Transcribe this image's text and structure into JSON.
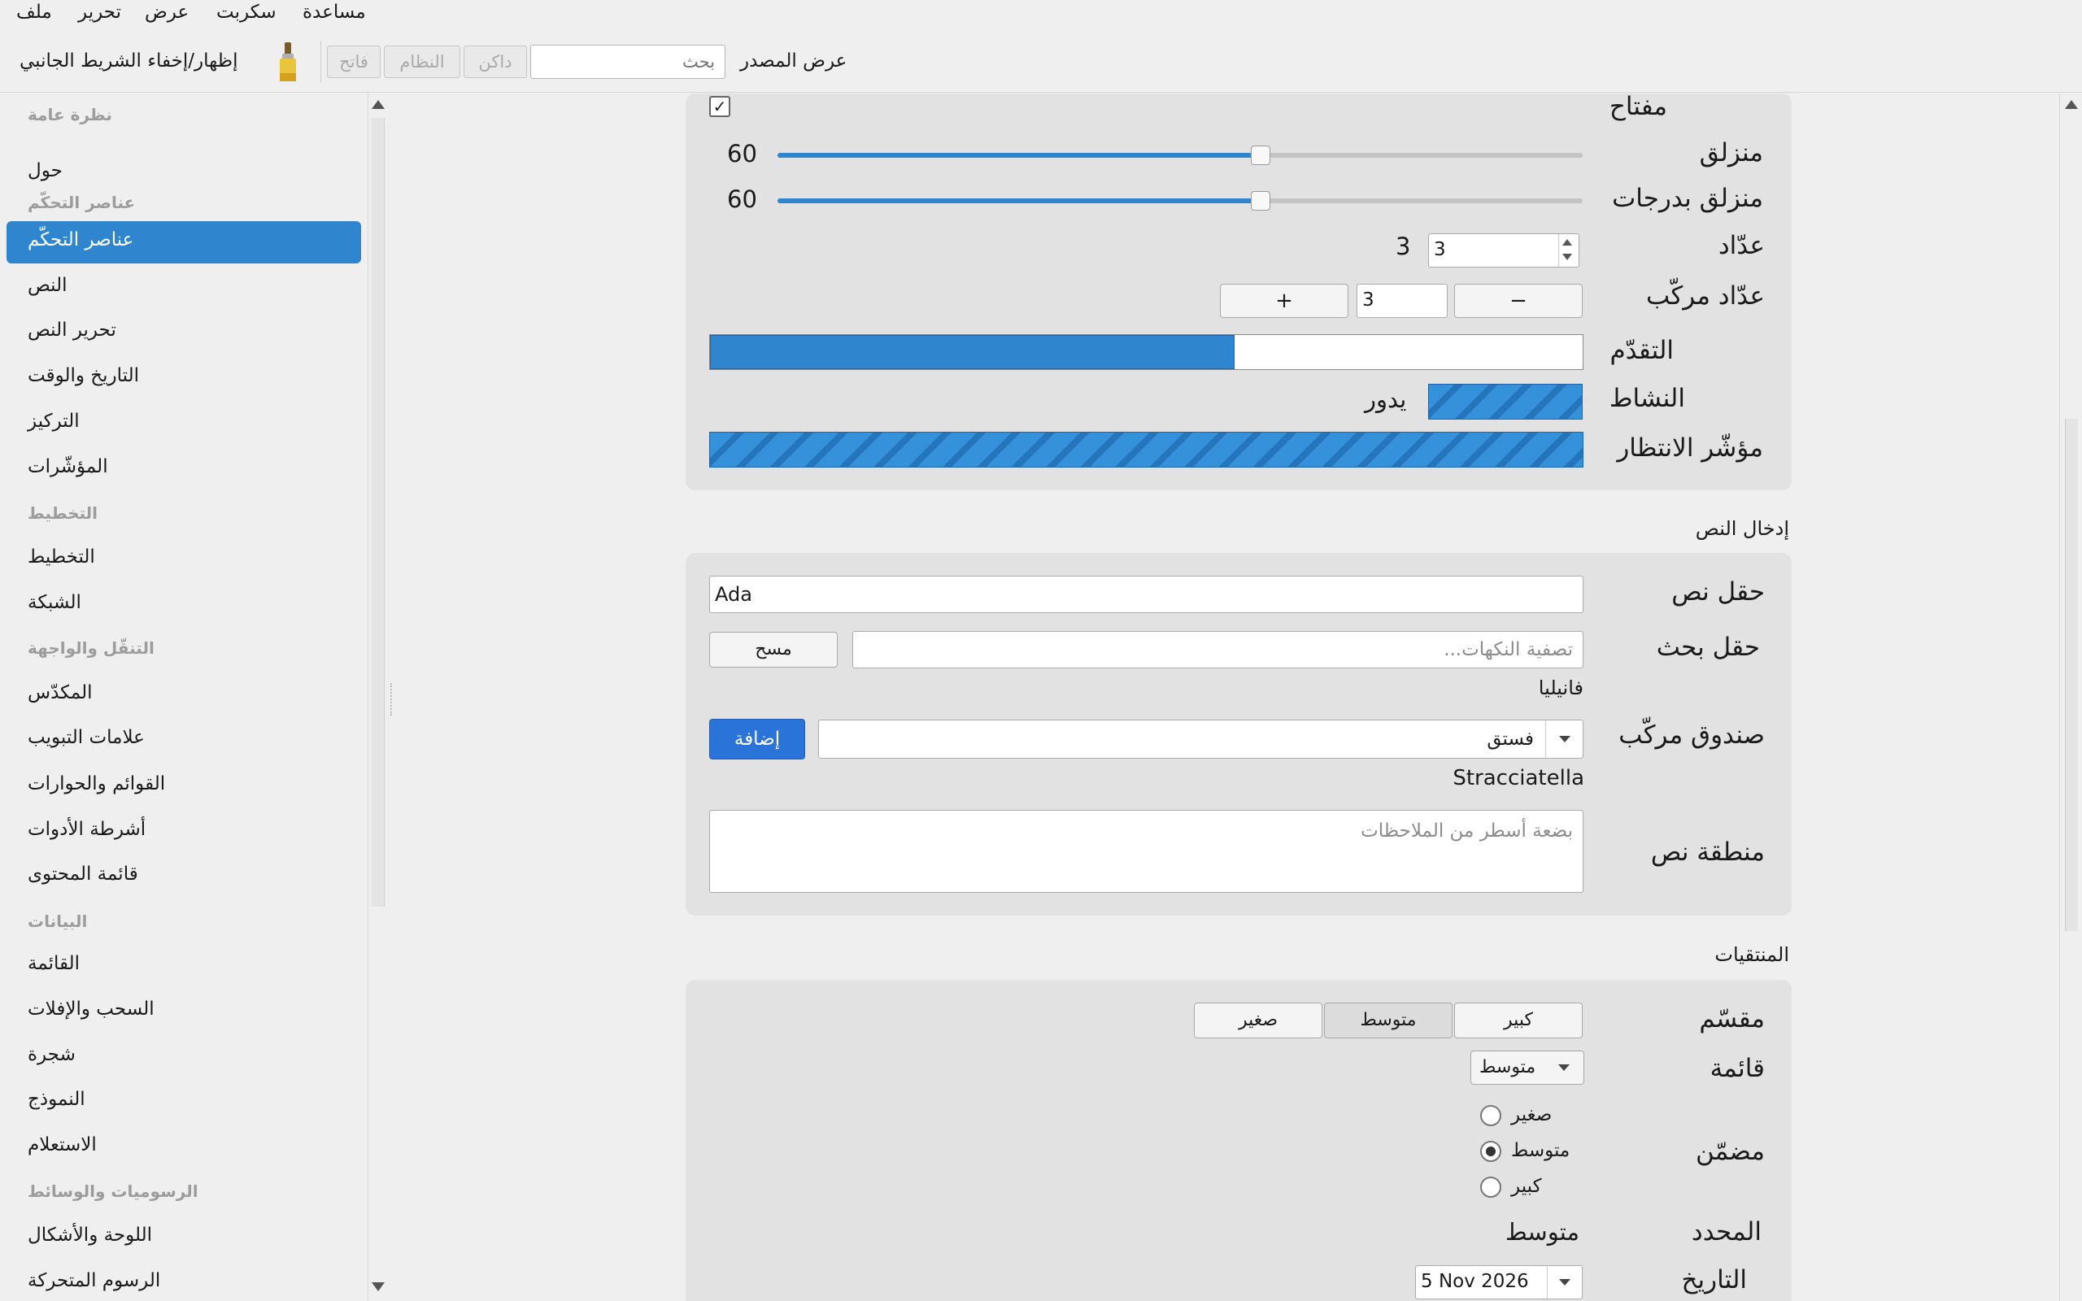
{
  "menu": {
    "file": "ملف",
    "edit": "تحرير",
    "view": "عرض",
    "script": "سكربت",
    "help": "مساعدة"
  },
  "toolbar": {
    "toggle_sidebar": "إظهار/إخفاء الشريط الجانبي",
    "light_button": "فاتح",
    "system_button": "النظام",
    "dark_button": "داكن",
    "search_placeholder": "بحث",
    "view_source": "عرض المصدر"
  },
  "sidebar": {
    "items": [
      {
        "label": "نظرة عامة",
        "type": "header"
      },
      {
        "label": "حول",
        "type": "item"
      },
      {
        "label": "عناصر التحكّم",
        "type": "header"
      },
      {
        "label": "عناصر التحكّم",
        "type": "selected"
      },
      {
        "label": "النص",
        "type": "item"
      },
      {
        "label": "تحرير النص",
        "type": "item"
      },
      {
        "label": "التاريخ والوقت",
        "type": "item"
      },
      {
        "label": "التركيز",
        "type": "item"
      },
      {
        "label": "المؤشّرات",
        "type": "item"
      },
      {
        "label": "التخطيط",
        "type": "header"
      },
      {
        "label": "التخطيط",
        "type": "item"
      },
      {
        "label": "الشبكة",
        "type": "item"
      },
      {
        "label": "التنقّل والواجهة",
        "type": "header"
      },
      {
        "label": "المكدّس",
        "type": "item"
      },
      {
        "label": "علامات التبويب",
        "type": "item"
      },
      {
        "label": "القوائم والحوارات",
        "type": "item"
      },
      {
        "label": "أشرطة الأدوات",
        "type": "item"
      },
      {
        "label": "قائمة المحتوى",
        "type": "item"
      },
      {
        "label": "البيانات",
        "type": "header"
      },
      {
        "label": "القائمة",
        "type": "item"
      },
      {
        "label": "السحب والإفلات",
        "type": "item"
      },
      {
        "label": "شجرة",
        "type": "item"
      },
      {
        "label": "النموذج",
        "type": "item"
      },
      {
        "label": "الاستعلام",
        "type": "item"
      },
      {
        "label": "الرسوميات والوسائط",
        "type": "header"
      },
      {
        "label": "اللوحة والأشكال",
        "type": "item"
      },
      {
        "label": "الرسوم المتحركة",
        "type": "item"
      }
    ]
  },
  "controls": {
    "switch_label": "مفتاح",
    "switch_checked": true,
    "check_mark": "✓",
    "slider_label": "منزلق",
    "slider_value": "60",
    "slider_fraction": 0.6,
    "step_slider_label": "منزلق بدرجات",
    "step_slider_value": "60",
    "step_slider_fraction": 0.6,
    "spin_label": "عدّاد",
    "spin_value": "3",
    "spin_readout": "3",
    "compound_spin_label": "عدّاد مركّب",
    "compound_minus": "−",
    "compound_value": "3",
    "compound_plus": "+",
    "progress_label": "التقدّم",
    "progress_fraction": 0.6,
    "activity_label": "النشاط",
    "activity_status": "يدور",
    "busy_label": "مؤشّر الانتظار"
  },
  "text_input": {
    "title": "إدخال النص",
    "text_field_label": "حقل نص",
    "text_field_value": "Ada",
    "search_field_label": "حقل بحث",
    "search_placeholder": "تصفية النكهات...",
    "clear_button": "مسح",
    "search_result": "فانيليا",
    "combo_label": "صندوق مركّب",
    "combo_value": "فستق",
    "add_button": "إضافة",
    "combo_result": "Stracciatella",
    "text_area_label": "منطقة نص",
    "text_area_placeholder": "بضعة أسطر من الملاحظات"
  },
  "pickers": {
    "title": "المنتقيات",
    "segmented_label": "مقسّم",
    "segments": [
      "كبير",
      "متوسط",
      "صغير"
    ],
    "segment_selected": "متوسط",
    "menu_label": "قائمة",
    "menu_value": "متوسط",
    "inline_label": "مضمّن",
    "radios": [
      "صغير",
      "متوسط",
      "كبير"
    ],
    "radio_selected": "متوسط",
    "selected_label": "المحدد",
    "selected_value": "متوسط",
    "date_label": "التاريخ",
    "date_value": "5 Nov 2026"
  }
}
